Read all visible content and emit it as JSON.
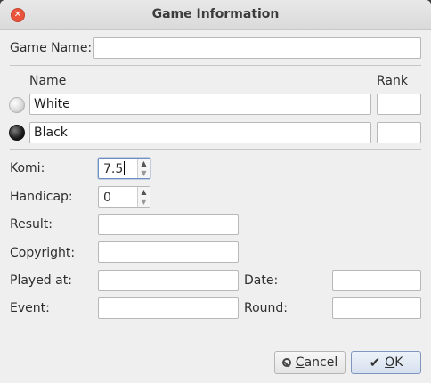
{
  "window": {
    "title": "Game Information",
    "close_glyph": "✕"
  },
  "game_name": {
    "label": "Game Name:",
    "value": ""
  },
  "players": {
    "name_header": "Name",
    "rank_header": "Rank",
    "white": {
      "icon": "white-stone-icon",
      "name": "White",
      "rank": ""
    },
    "black": {
      "icon": "black-stone-icon",
      "name": "Black",
      "rank": ""
    }
  },
  "komi": {
    "label": "Komi:",
    "value": "7.5"
  },
  "handicap": {
    "label": "Handicap:",
    "value": "0"
  },
  "result": {
    "label": "Result:",
    "value": ""
  },
  "copyright": {
    "label": "Copyright:",
    "value": ""
  },
  "played_at": {
    "label": "Played at:",
    "value": ""
  },
  "date": {
    "label": "Date:",
    "value": ""
  },
  "event": {
    "label": "Event:",
    "value": ""
  },
  "round": {
    "label": "Round:",
    "value": ""
  },
  "buttons": {
    "cancel": {
      "label_accel": "C",
      "label_rest": "ancel"
    },
    "ok": {
      "label_accel": "O",
      "label_rest": "K"
    }
  },
  "spin_arrows": {
    "up": "▲",
    "down": "▼"
  },
  "colors": {
    "close": "#e9543b",
    "window_bg": "#efefef",
    "ok_border": "#7f97bd"
  }
}
